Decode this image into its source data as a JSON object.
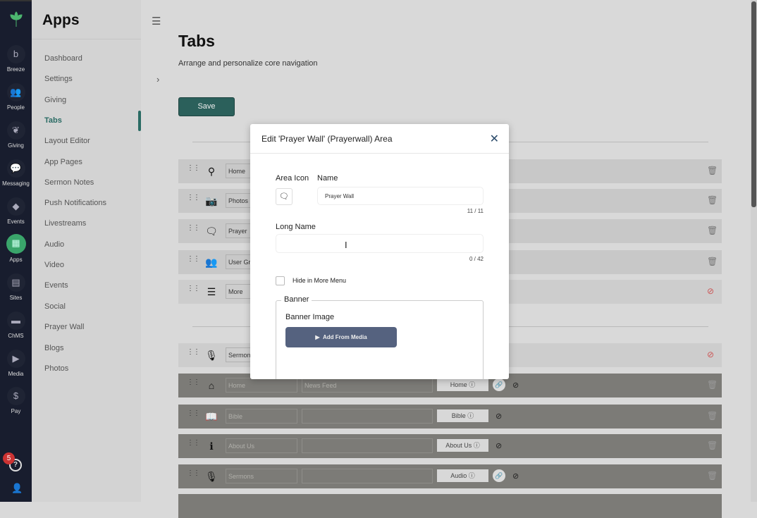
{
  "rail": {
    "items": [
      {
        "label": "Breeze",
        "icon": "b"
      },
      {
        "label": "People",
        "icon": "👥"
      },
      {
        "label": "Giving",
        "icon": "❦"
      },
      {
        "label": "Messaging",
        "icon": "💬"
      },
      {
        "label": "Events",
        "icon": "◆"
      },
      {
        "label": "Apps",
        "icon": "▦"
      },
      {
        "label": "Sites",
        "icon": "▤"
      },
      {
        "label": "ChMS",
        "icon": "▬"
      },
      {
        "label": "Media",
        "icon": "▶"
      },
      {
        "label": "Pay",
        "icon": "$"
      }
    ],
    "badge": "5",
    "help": "?"
  },
  "sidebar": {
    "title": "Apps",
    "items": [
      "Dashboard",
      "Settings",
      "Giving",
      "Tabs",
      "Layout Editor",
      "App Pages",
      "Sermon Notes",
      "Push Notifications",
      "Livestreams",
      "Audio",
      "Video",
      "Events",
      "Social",
      "Prayer Wall",
      "Blogs",
      "Photos"
    ]
  },
  "main": {
    "title": "Tabs",
    "subtitle": "Arrange and personalize core navigation",
    "save_label": "Save",
    "top_rows": [
      {
        "icon": "⚲",
        "name": "Home"
      },
      {
        "icon": "📷",
        "name": "Photos"
      },
      {
        "icon": "🗨",
        "name": "Prayer"
      },
      {
        "icon": "👥",
        "name": "User Gr"
      },
      {
        "icon": "☰",
        "name": "More"
      }
    ],
    "bottom_rows": [
      {
        "icon": "🎙",
        "name": "Sermon",
        "long": "",
        "label": ""
      },
      {
        "icon": "⌂",
        "name": "Home",
        "long": "News Feed",
        "label": "Home ⓘ"
      },
      {
        "icon": "📖",
        "name": "Bible",
        "long": "",
        "label": "Bible ⓘ"
      },
      {
        "icon": "ℹ",
        "name": "About Us",
        "long": "",
        "label": "About Us ⓘ"
      },
      {
        "icon": "🎙",
        "name": "Sermons",
        "long": "",
        "label": "Audio ⓘ"
      }
    ]
  },
  "modal": {
    "title": "Edit 'Prayer Wall' (Prayerwall) Area",
    "area_icon_label": "Area Icon",
    "name_label": "Name",
    "name_value": "Prayer Wall",
    "name_count": "11 / 11",
    "long_name_label": "Long Name",
    "long_name_value": "",
    "long_name_count": "0 / 42",
    "hide_label": "Hide in More Menu",
    "banner_legend": "Banner",
    "banner_image_label": "Banner Image",
    "add_media_label": "Add From Media"
  }
}
